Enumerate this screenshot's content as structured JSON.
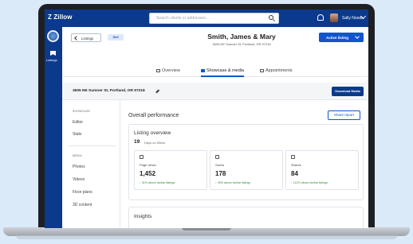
{
  "topbar": {
    "logo": "Z Zillow",
    "search_placeholder": "Search clients or addresses...",
    "user_name": "Sally Noods"
  },
  "rail": {
    "listings_label": "Listings"
  },
  "header": {
    "back_label": "Listings",
    "status_badge": "Sell",
    "owner_title": "Smith, James & Mary",
    "owner_address": "3605 NE Sumner St, Portland, OR 97218",
    "active_button": "Active listing"
  },
  "tabs": [
    {
      "label": "Overview",
      "active": false
    },
    {
      "label": "Showcase & media",
      "active": true
    },
    {
      "label": "Appointments",
      "active": false
    }
  ],
  "address_bar": {
    "address": "3605 NE Sumner St, Portland, OR 97218",
    "download_label": "Download Media"
  },
  "subnav": {
    "section1_head": "SHOWCASE",
    "items1": [
      "Editor",
      "Stats"
    ],
    "section2_head": "MEDIA",
    "items2": [
      "Photos",
      "Videos",
      "Floor plans",
      "3D content"
    ]
  },
  "content": {
    "overall_title": "Overall performance",
    "share_label": "Share report",
    "listing_overview_title": "Listing overview",
    "days_value": "19",
    "days_label": "Days on Zillow",
    "stats": [
      {
        "icon": "eye-icon",
        "label": "Page views",
        "value": "1,452",
        "trend": "↑ 31% above similar listings"
      },
      {
        "icon": "heart-icon",
        "label": "Saves",
        "value": "178",
        "trend": "↑ 40% above similar listings"
      },
      {
        "icon": "share-icon",
        "label": "Shares",
        "value": "84",
        "trend": "↑ 112% above similar listings"
      }
    ],
    "insights_title": "Insights"
  },
  "colors": {
    "brand": "#0b3a8c",
    "accent": "#1155cc",
    "positive": "#2b8a3e"
  }
}
